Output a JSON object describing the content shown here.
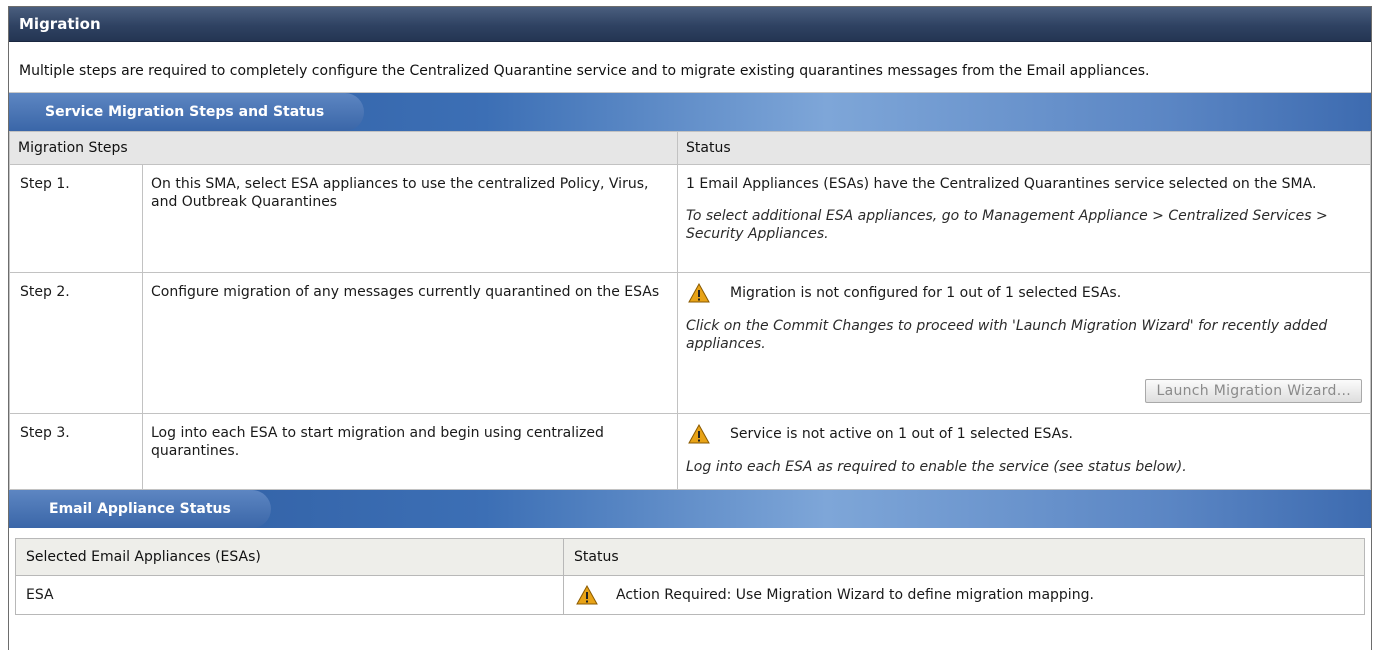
{
  "panel": {
    "title": "Migration"
  },
  "intro": {
    "text": "Multiple steps are required to completely configure the Centralized Quarantine service and to migrate existing quarantines messages from the Email appliances."
  },
  "migration_section": {
    "title": "Service Migration Steps and Status",
    "col_steps": "Migration Steps",
    "col_status": "Status",
    "steps": [
      {
        "num": "Step 1.",
        "desc": "On this SMA, select ESA appliances to use the centralized Policy, Virus, and Outbreak Quarantines",
        "status": "1 Email Appliances (ESAs) have the Centralized Quarantines service selected on the SMA.",
        "note": "To select additional ESA appliances, go to Management Appliance > Centralized Services > Security Appliances."
      },
      {
        "num": "Step 2.",
        "desc": "Configure migration of any messages currently quarantined on the ESAs",
        "status": "Migration is not configured for 1 out of 1 selected ESAs.",
        "note": "Click on the Commit Changes to proceed with 'Launch Migration Wizard' for recently added appliances.",
        "button": "Launch Migration Wizard..."
      },
      {
        "num": "Step 3.",
        "desc": "Log into each ESA to start migration and begin using centralized quarantines.",
        "status": "Service is not active on 1 out of 1 selected ESAs.",
        "note": "Log into each ESA as required to enable the service (see status below)."
      }
    ]
  },
  "esa_section": {
    "title": "Email Appliance Status",
    "col_esa": "Selected Email Appliances (ESAs)",
    "col_status": "Status",
    "rows": [
      {
        "name": "ESA",
        "status": "Action Required: Use Migration Wizard to define migration mapping."
      }
    ]
  },
  "icons": {
    "warning": "warning-icon"
  },
  "colors": {
    "header_bg": "#2f4262",
    "section_bar": "#3c6fb5",
    "warning": "#e8a317"
  }
}
